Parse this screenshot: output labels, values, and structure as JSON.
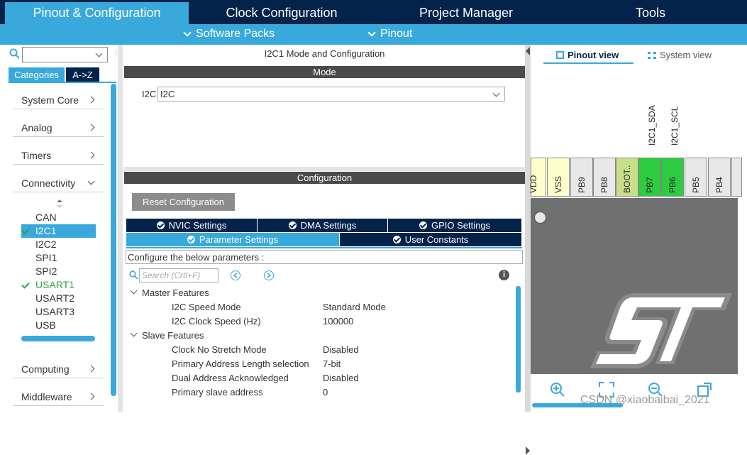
{
  "top_tabs": [
    "Pinout & Configuration",
    "Clock Configuration",
    "Project Manager",
    "Tools"
  ],
  "sub_tabs": [
    "Software Packs",
    "Pinout"
  ],
  "sidebar": {
    "tab_categories": "Categories",
    "tab_az": "A->Z",
    "categories": [
      "System Core",
      "Analog",
      "Timers",
      "Connectivity",
      "Computing",
      "Middleware"
    ],
    "peripherals": [
      "CAN",
      "I2C1",
      "I2C2",
      "SPI1",
      "SPI2",
      "USART1",
      "USART2",
      "USART3",
      "USB"
    ]
  },
  "center": {
    "header": "I2C1 Mode and Configuration",
    "mode_bar": "Mode",
    "mode_label": "I2C",
    "mode_value": "I2C",
    "config_bar": "Configuration",
    "reset_button": "Reset Configuration",
    "tabs": [
      "NVIC Settings",
      "DMA Settings",
      "GPIO Settings",
      "Parameter Settings",
      "User Constants"
    ],
    "configure_hint": "Configure the below parameters :",
    "search_placeholder": "Search (Crtl+F)",
    "groups": {
      "master": "Master Features",
      "slave": "Slave Features"
    },
    "params": [
      {
        "name": "I2C Speed Mode",
        "value": "Standard Mode"
      },
      {
        "name": "I2C Clock Speed (Hz)",
        "value": "100000"
      },
      {
        "name": "Clock No Stretch Mode",
        "value": "Disabled"
      },
      {
        "name": "Primary Address Length selection",
        "value": "7-bit"
      },
      {
        "name": "Dual Address Acknowledged",
        "value": "Disabled"
      },
      {
        "name": "Primary slave address",
        "value": "0"
      }
    ]
  },
  "right": {
    "pinout_view": "Pinout view",
    "system_view": "System view",
    "signal_labels": [
      "I2C1_SDA",
      "I2C1_SCL"
    ],
    "pins": [
      "VDD",
      "VSS",
      "PB9",
      "PB8",
      "BOOT..",
      "PB7",
      "PB6",
      "PB5",
      "PB4"
    ]
  },
  "watermark": "CSDN @xiaobaibai_2021",
  "colors": {
    "navy": "#03234b",
    "accent": "#39a9dc",
    "pin_green": "#2ecc40",
    "pin_yellow": "#ffffcc"
  }
}
